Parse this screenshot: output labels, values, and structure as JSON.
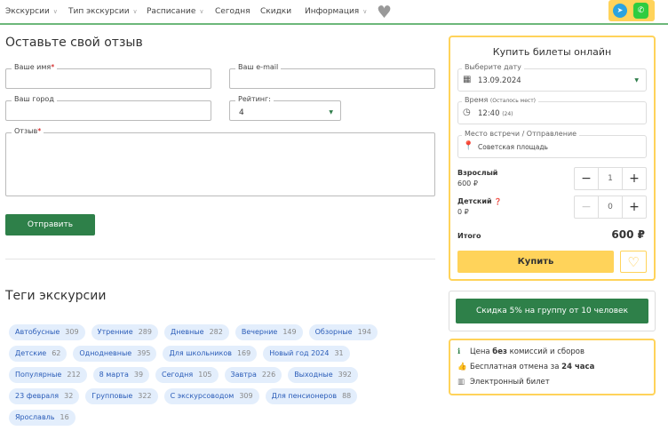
{
  "nav": {
    "items": [
      "Экскурсии",
      "Тип экскурсии",
      "Расписание",
      "Сегодня",
      "Скидки",
      "Информация"
    ]
  },
  "review": {
    "title": "Оставьте свой отзыв",
    "name_label": "Ваше имя",
    "email_label": "Ваш e-mail",
    "city_label": "Ваш город",
    "rating_label": "Рейтинг:",
    "rating_value": "4",
    "review_label": "Отзыв",
    "required": "*",
    "submit": "Отправить"
  },
  "tags": {
    "title": "Теги экскурсии",
    "items": [
      {
        "label": "Автобусные",
        "count": "309"
      },
      {
        "label": "Утренние",
        "count": "289"
      },
      {
        "label": "Дневные",
        "count": "282"
      },
      {
        "label": "Вечерние",
        "count": "149"
      },
      {
        "label": "Обзорные",
        "count": "194"
      },
      {
        "label": "Детские",
        "count": "62"
      },
      {
        "label": "Однодневные",
        "count": "395"
      },
      {
        "label": "Для школьников",
        "count": "169"
      },
      {
        "label": "Новый год 2024",
        "count": "31"
      },
      {
        "label": "Популярные",
        "count": "212"
      },
      {
        "label": "8 марта",
        "count": "39"
      },
      {
        "label": "Сегодня",
        "count": "105"
      },
      {
        "label": "Завтра",
        "count": "226"
      },
      {
        "label": "Выходные",
        "count": "392"
      },
      {
        "label": "23 февраля",
        "count": "32"
      },
      {
        "label": "Групповые",
        "count": "322"
      },
      {
        "label": "С экскурсоводом",
        "count": "309"
      },
      {
        "label": "Для пенсионеров",
        "count": "88"
      },
      {
        "label": "Ярославль",
        "count": "16"
      }
    ]
  },
  "buy": {
    "title": "Купить билеты онлайн",
    "date_label": "Выберите дату",
    "date_value": "13.09.2024",
    "time_label": "Время",
    "time_note": "(Осталось мест)",
    "time_value": "12:40",
    "time_seats": "(24)",
    "place_label": "Место встречи / Отправление",
    "place_value": "Советская площадь",
    "adult_label": "Взрослый",
    "adult_price": "600 ₽",
    "adult_qty": "1",
    "child_label": "Детский",
    "child_price": "0 ₽",
    "child_qty": "0",
    "total_label": "Итого",
    "total_value": "600 ₽",
    "buy_button": "Купить"
  },
  "discount": "Скидка 5% на группу от 10 человек",
  "info": {
    "line1_a": "Цена ",
    "line1_b": "без",
    "line1_c": " комиссий и сборов",
    "line2_a": "Бесплатная отмена за ",
    "line2_b": "24 часа",
    "line3": "Электронный билет"
  }
}
